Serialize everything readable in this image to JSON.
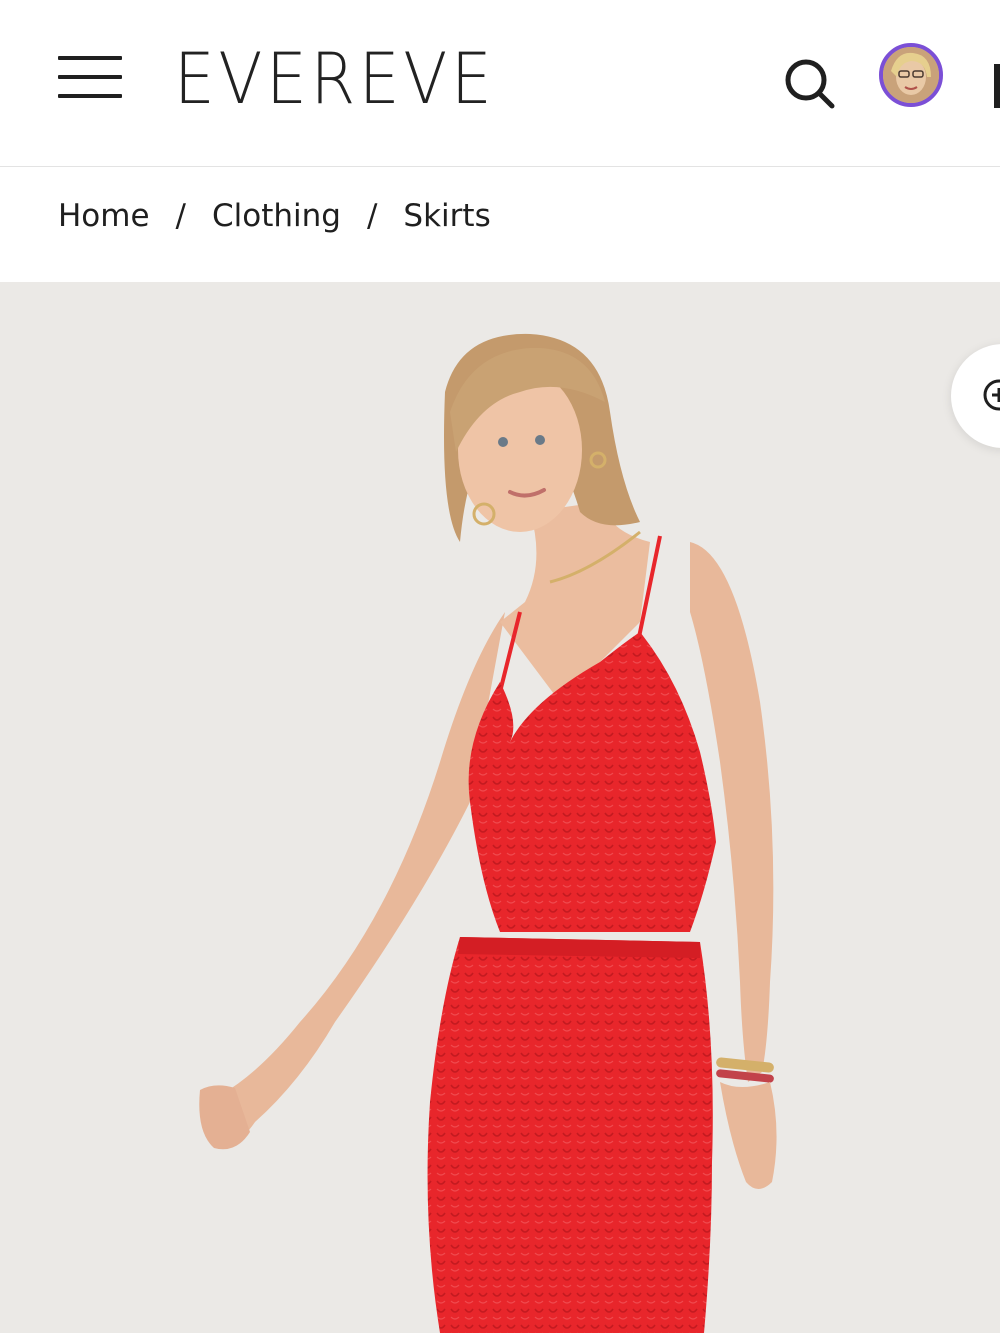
{
  "header": {
    "brand": "EVEREVE",
    "menu_icon": "hamburger-menu-icon",
    "search_icon": "search-icon",
    "avatar": "user-avatar",
    "cart_icon": "shopping-bag-icon",
    "accent_color": "#7b4fd6"
  },
  "breadcrumb": {
    "items": [
      "Home",
      "Clothing",
      "Skirts"
    ],
    "separator": "/"
  },
  "gallery": {
    "zoom_icon": "zoom-in-icon",
    "product_color": "#e8262b"
  }
}
